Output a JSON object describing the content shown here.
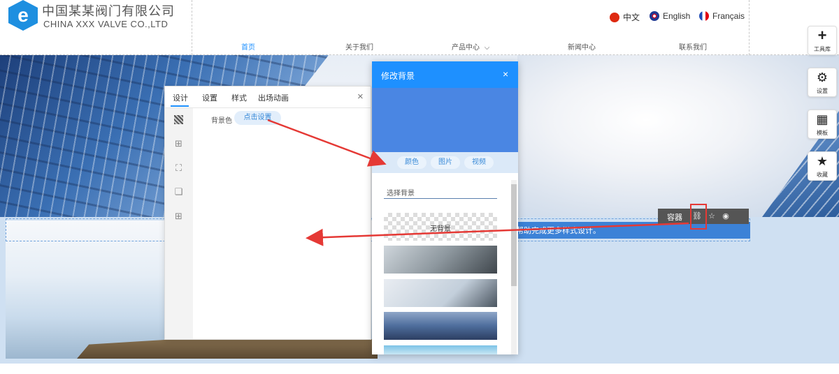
{
  "brand": {
    "cn": "中国某某阀门有限公司",
    "en": "CHINA XXX VALVE CO.,LTD"
  },
  "languages": [
    {
      "label": "中文",
      "flag_color": "#de2910"
    },
    {
      "label": "English",
      "flag_color": "#1f3a93"
    },
    {
      "label": "Français",
      "flag_color": "#1f4bb5"
    }
  ],
  "nav": [
    "首页",
    "关于我们",
    "产品中心",
    "新闻中心",
    "联系我们"
  ],
  "nav_dropdown_icon": "chevron-down-icon",
  "accent_color": "#1e90ff",
  "edit_panel": {
    "tabs": [
      "设计",
      "设置",
      "样式",
      "出场动画"
    ],
    "close": "×",
    "bg_label": "背景色",
    "bg_button": "点击设置",
    "side_icons": [
      "texture-icon",
      "border-icon",
      "margin-icon",
      "shadow-icon",
      "layout-icon"
    ]
  },
  "bg_panel": {
    "title": "修改背景",
    "close": "×",
    "tabs": [
      "颜色",
      "图片",
      "视频"
    ],
    "choose_label": "选择背景",
    "options": [
      "无背景"
    ]
  },
  "floating_toolbar": {
    "label": "容器"
  },
  "banner_text": "帮助完成更多样式设计。",
  "rail": [
    {
      "label": "工具库",
      "icon": "plus-icon"
    },
    {
      "label": "设置",
      "icon": "gear-icon"
    },
    {
      "label": "模板",
      "icon": "template-icon"
    },
    {
      "label": "收藏",
      "icon": "star-icon"
    }
  ]
}
